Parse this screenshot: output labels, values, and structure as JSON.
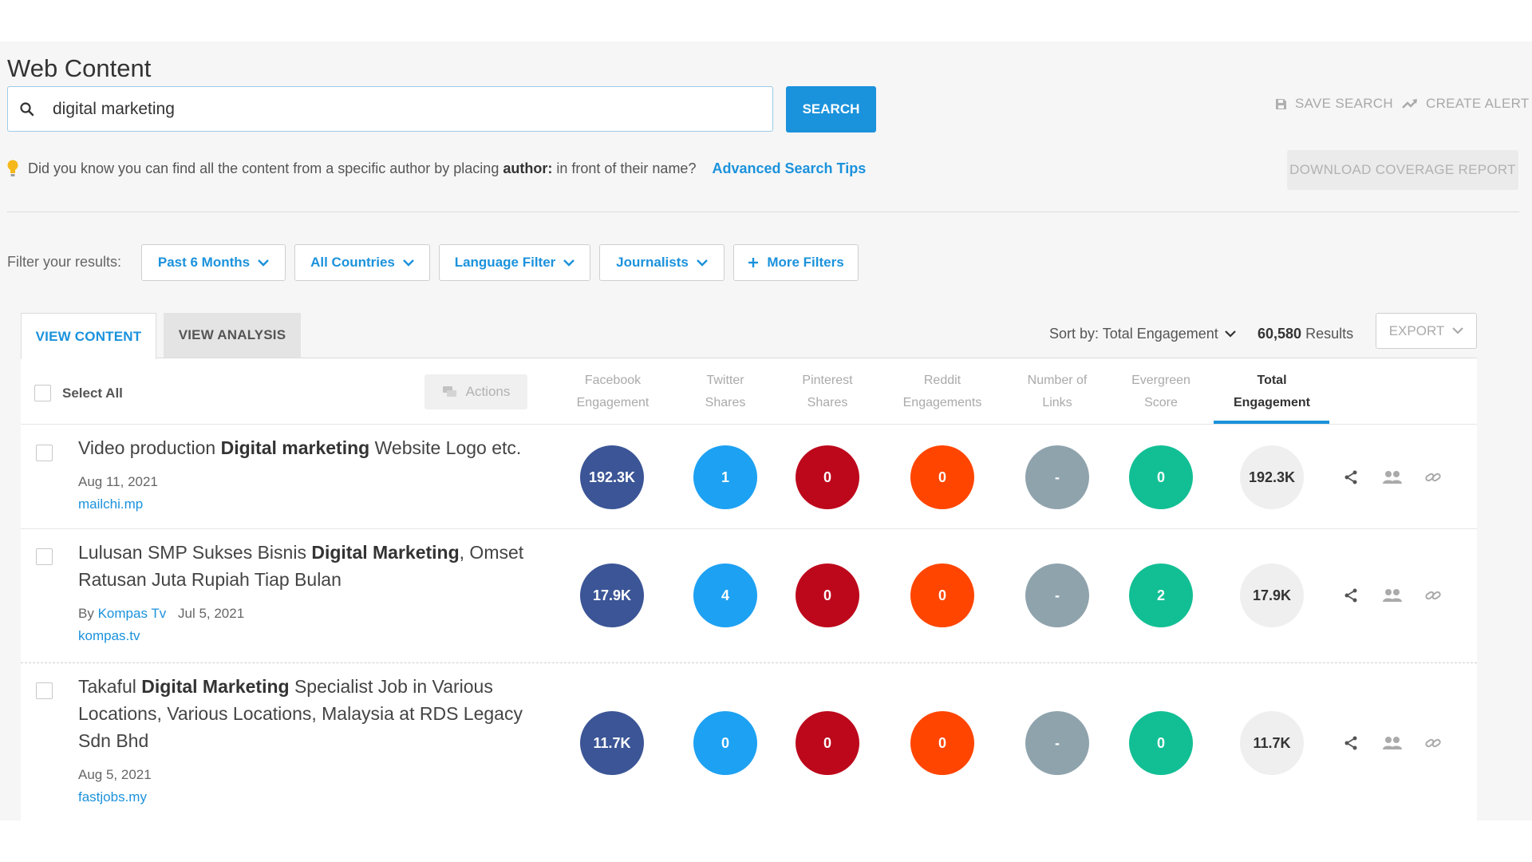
{
  "page": {
    "title": "Web Content"
  },
  "search": {
    "value": "digital marketing",
    "button_label": "SEARCH"
  },
  "top_actions": {
    "save_search": "SAVE SEARCH",
    "create_alert": "CREATE ALERT",
    "download_report": "DOWNLOAD COVERAGE REPORT"
  },
  "tip": {
    "text_before": "Did you know you can find all the content from a specific author by placing",
    "keyword": "author:",
    "text_after": "in front of their name?",
    "link": "Advanced Search Tips"
  },
  "filters": {
    "label": "Filter your results:",
    "items": [
      "Past 6 Months",
      "All Countries",
      "Language Filter",
      "Journalists"
    ],
    "more": "More Filters"
  },
  "tabs": {
    "view_content": "VIEW CONTENT",
    "view_analysis": "VIEW ANALYSIS"
  },
  "sort": {
    "label": "Sort by: Total Engagement",
    "results_count": "60,580",
    "results_label": "Results",
    "export": "EXPORT"
  },
  "table": {
    "select_all": "Select All",
    "actions": "Actions",
    "columns": [
      {
        "line1": "Facebook",
        "line2": "Engagement"
      },
      {
        "line1": "Twitter",
        "line2": "Shares"
      },
      {
        "line1": "Pinterest",
        "line2": "Shares"
      },
      {
        "line1": "Reddit",
        "line2": "Engagements"
      },
      {
        "line1": "Number of",
        "line2": "Links"
      },
      {
        "line1": "Evergreen",
        "line2": "Score"
      },
      {
        "line1": "Total",
        "line2": "Engagement"
      }
    ],
    "rows": [
      {
        "title": {
          "pre": "Video production ",
          "bold": "Digital marketing",
          "post": " Website Logo etc."
        },
        "author_prefix": "",
        "author": "",
        "date": "Aug 11, 2021",
        "domain": "mailchi.mp",
        "metrics": {
          "facebook": "192.3K",
          "twitter": "1",
          "pinterest": "0",
          "reddit": "0",
          "links": "-",
          "evergreen": "0",
          "total": "192.3K"
        }
      },
      {
        "title": {
          "pre": "Lulusan SMP Sukses Bisnis ",
          "bold": "Digital Marketing",
          "post": ", Omset Ratusan Juta Rupiah Tiap Bulan"
        },
        "author_prefix": "By",
        "author": "Kompas Tv",
        "date": "Jul 5, 2021",
        "domain": "kompas.tv",
        "metrics": {
          "facebook": "17.9K",
          "twitter": "4",
          "pinterest": "0",
          "reddit": "0",
          "links": "-",
          "evergreen": "2",
          "total": "17.9K"
        }
      },
      {
        "title": {
          "pre": "Takaful ",
          "bold": "Digital Marketing",
          "post": " Specialist Job in Various Locations, Various Locations, Malaysia at RDS Legacy Sdn Bhd"
        },
        "author_prefix": "",
        "author": "",
        "date": "Aug 5, 2021",
        "domain": "fastjobs.my",
        "metrics": {
          "facebook": "11.7K",
          "twitter": "0",
          "pinterest": "0",
          "reddit": "0",
          "links": "-",
          "evergreen": "0",
          "total": "11.7K"
        }
      }
    ]
  },
  "colors": {
    "accent": "#1b92dc",
    "facebook": "#3b5596",
    "twitter": "#1da1f2",
    "pinterest": "#bd081c",
    "reddit": "#ff4500",
    "links": "#8fa3ad",
    "evergreen": "#12bf94",
    "total": "#efefef",
    "tip_bulb": "#f5b81a"
  },
  "icons": {
    "search": "search-icon",
    "save": "save-icon",
    "alert": "trend-up-icon",
    "bulb": "lightbulb-icon",
    "chevron": "chevron-down-icon",
    "plus": "plus-icon",
    "actions": "chat-bubbles-icon",
    "row_actions": [
      "share-icon",
      "people-icon",
      "link-icon"
    ]
  }
}
